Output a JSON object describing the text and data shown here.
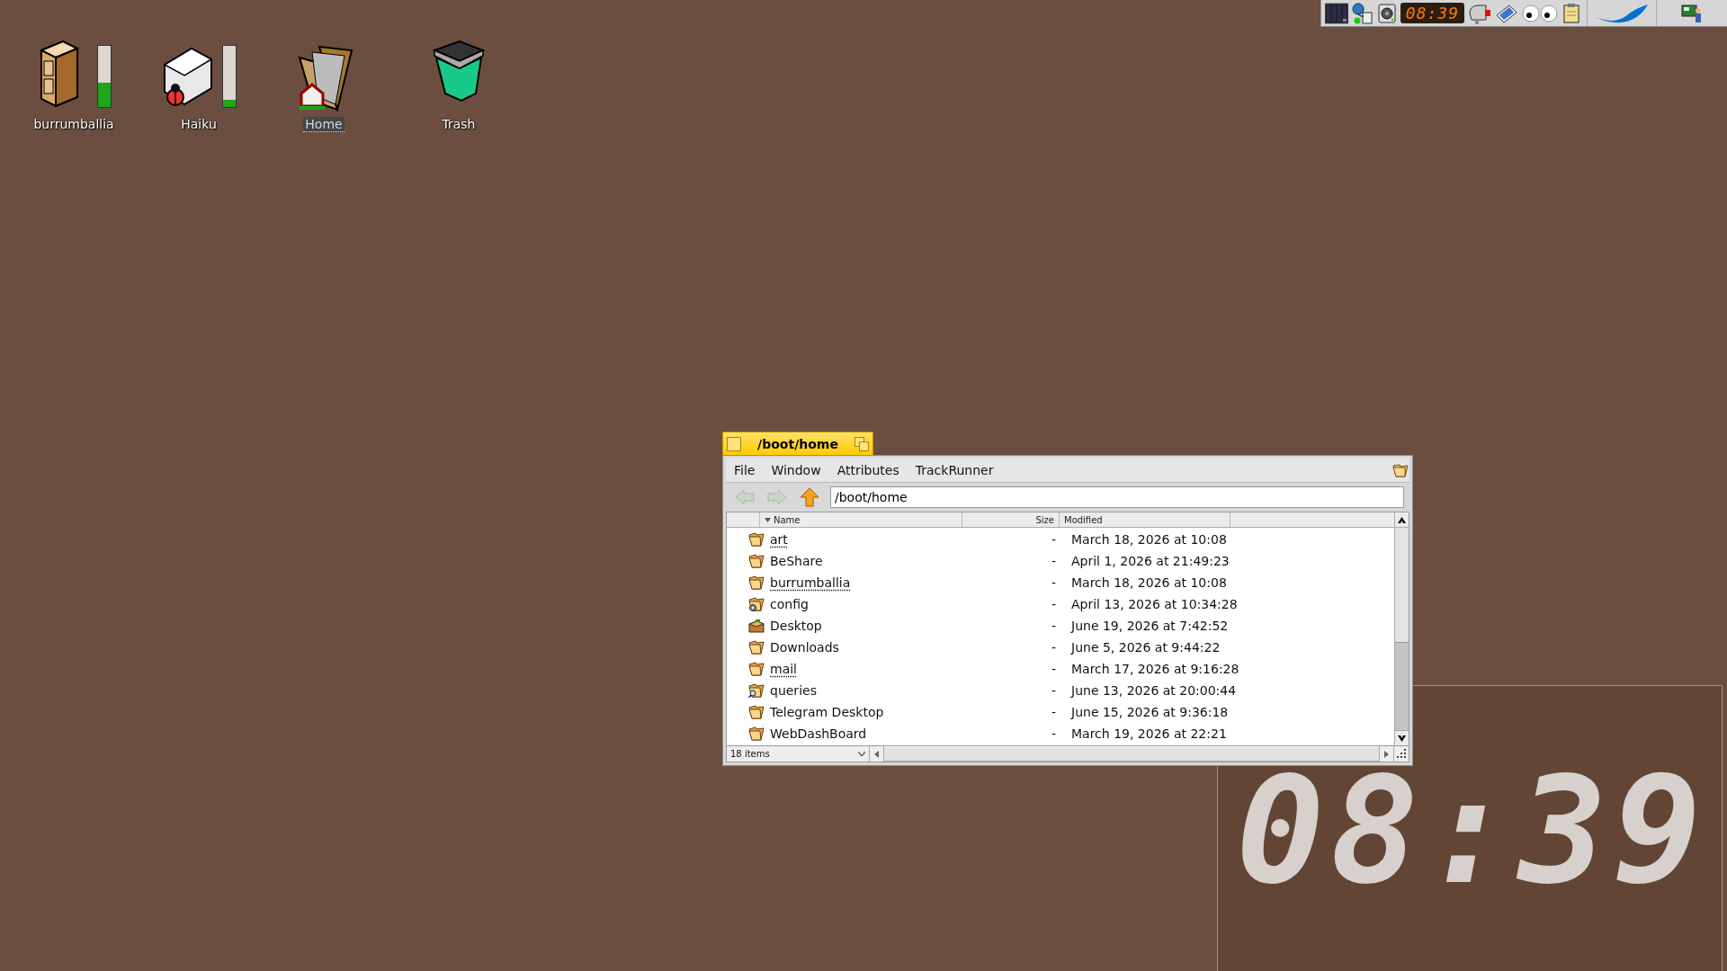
{
  "desktop_icons": [
    {
      "label": "burrumballia",
      "kind": "volume",
      "level": 0.4,
      "selected": false,
      "link": false
    },
    {
      "label": "Haiku",
      "kind": "boot-volume",
      "level": 0.12,
      "selected": false,
      "link": false
    },
    {
      "label": "Home",
      "kind": "home-folder",
      "selected": true,
      "link": true
    },
    {
      "label": "Trash",
      "kind": "trash",
      "selected": false,
      "link": false
    }
  ],
  "deskbar": {
    "clock": "08:39"
  },
  "window": {
    "title": "/boot/home",
    "menu": [
      "File",
      "Window",
      "Attributes",
      "TrackRunner"
    ],
    "navigation": [
      {
        "kind": "back",
        "disabled": true
      },
      {
        "kind": "forward",
        "disabled": true
      },
      {
        "kind": "up",
        "disabled": false
      }
    ],
    "path": "/boot/home",
    "columns": [
      {
        "label": "Name",
        "sorted": true
      },
      {
        "label": "Size",
        "sorted": false
      },
      {
        "label": "Modified",
        "sorted": false
      }
    ],
    "files": [
      {
        "name": "art",
        "kind": "folder",
        "link": true,
        "size": "-",
        "modified": "March 18, 2026 at 10:08"
      },
      {
        "name": "BeShare",
        "kind": "folder",
        "link": false,
        "size": "-",
        "modified": "April 1, 2026 at 21:49:23"
      },
      {
        "name": "burrumballia",
        "kind": "folder",
        "link": true,
        "size": "-",
        "modified": "March 18, 2026 at 10:08"
      },
      {
        "name": "config",
        "kind": "settings-folder",
        "link": false,
        "size": "-",
        "modified": "April 13, 2026 at 10:34:28"
      },
      {
        "name": "Desktop",
        "kind": "desktop",
        "link": false,
        "size": "-",
        "modified": "June 19, 2026 at 7:42:52"
      },
      {
        "name": "Downloads",
        "kind": "folder",
        "link": false,
        "size": "-",
        "modified": "June 5, 2026 at 9:44:22"
      },
      {
        "name": "mail",
        "kind": "folder",
        "link": true,
        "size": "-",
        "modified": "March 17, 2026 at 9:16:28"
      },
      {
        "name": "queries",
        "kind": "query-folder",
        "link": false,
        "size": "-",
        "modified": "June 13, 2026 at 20:00:44"
      },
      {
        "name": "Telegram Desktop",
        "kind": "folder",
        "link": false,
        "size": "-",
        "modified": "June 15, 2026 at 9:36:18"
      },
      {
        "name": "WebDashBoard",
        "kind": "folder",
        "link": false,
        "size": "-",
        "modified": "March 19, 2026 at 22:21"
      }
    ],
    "status": "18 items"
  },
  "clock_replicant": {
    "time": "08:39"
  }
}
